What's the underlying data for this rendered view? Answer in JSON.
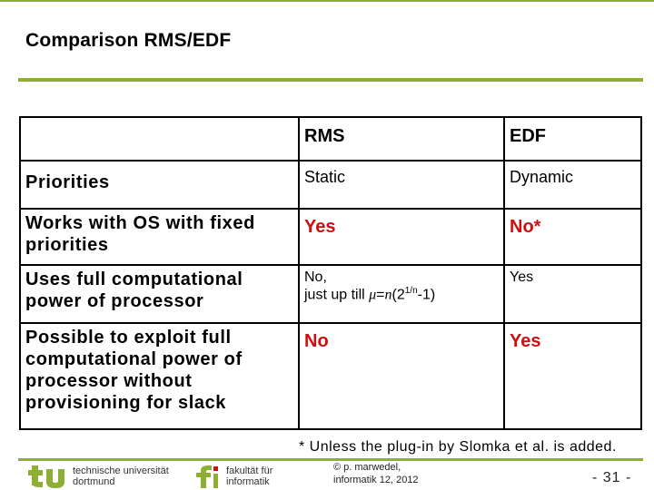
{
  "slide": {
    "title": "Comparison RMS/EDF",
    "accent_color": "#8db033",
    "highlight_color": "#cc1010"
  },
  "table": {
    "headers": [
      "",
      "RMS",
      "EDF"
    ],
    "rows": [
      {
        "label": "Priorities",
        "rms": "Static",
        "edf": "Dynamic"
      },
      {
        "label": "Works with OS with fixed priorities",
        "rms": "Yes",
        "edf": "No*"
      },
      {
        "label": "Uses full computational power of processor",
        "rms_line1": "No,",
        "rms_line2_prefix": "just up till ",
        "rms_mu": "μ",
        "rms_eq": "=",
        "rms_n": "n",
        "rms_paren_open": "(2",
        "rms_sup": "1/n",
        "rms_tail": "-1)",
        "edf": "Yes"
      },
      {
        "label": "Possible to exploit full computational power of processor without provisioning for slack",
        "rms": "No",
        "edf": "Yes"
      }
    ]
  },
  "footnote": "* Unless the plug-in by Slomka et al. is added.",
  "footer": {
    "tu_logo": "tu",
    "tu_line1": "technische universität",
    "tu_line2": "dortmund",
    "fi_logo": "fi",
    "fi_line1": "fakultät für",
    "fi_line2": "informatik",
    "copyright_line1": "© p. marwedel,",
    "copyright_line2": "informatik 12,  2012",
    "page": "- 31 -"
  }
}
